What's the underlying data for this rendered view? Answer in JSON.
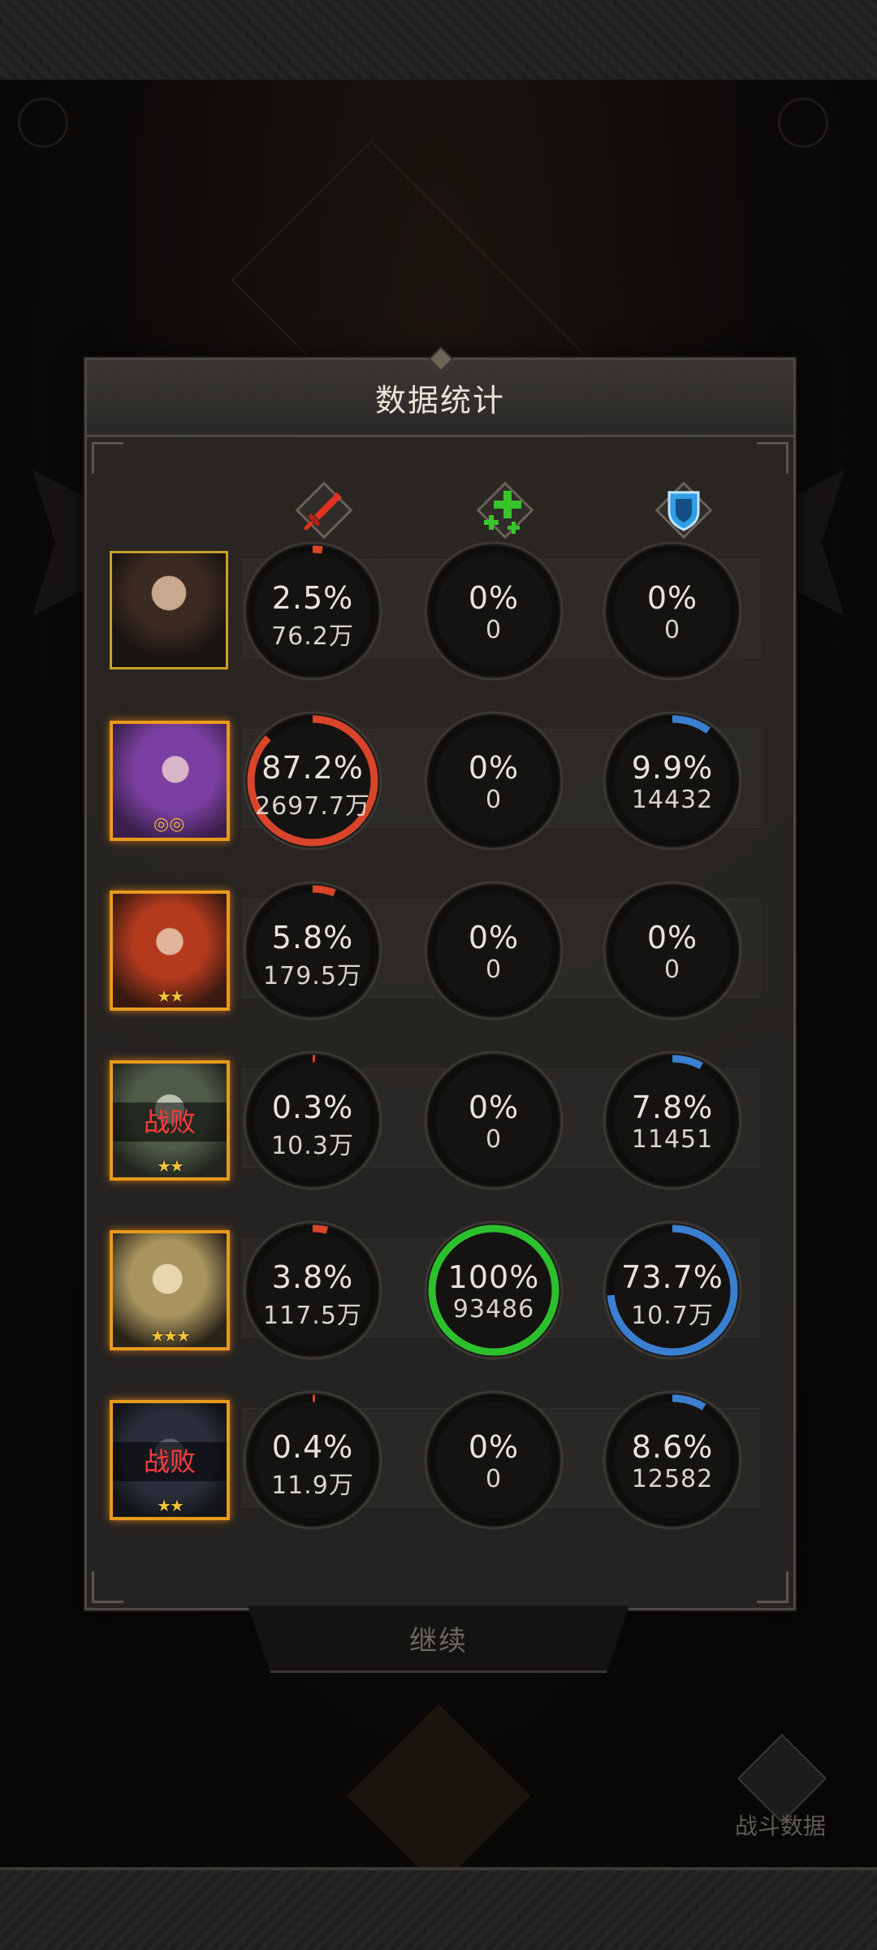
{
  "panel": {
    "title": "数据统计"
  },
  "columns": [
    {
      "name": "damage",
      "icon": "sword-icon",
      "color": "#e0331f"
    },
    {
      "name": "heal",
      "icon": "heal-cross-icon",
      "color": "#39c42a"
    },
    {
      "name": "defense",
      "icon": "shield-icon",
      "color": "#2f9fe6"
    }
  ],
  "colors": {
    "damage_ring": "#d9452a",
    "heal_ring": "#2cc12c",
    "defense_ring": "#3b7fd0",
    "defeated_text": "#ff3b3b"
  },
  "heroes": [
    {
      "defeated": false,
      "defeat_label": "",
      "stars": "",
      "damage": {
        "pct": "2.5%",
        "amount": "76.2万",
        "fill": 0.025
      },
      "heal": {
        "pct": "0%",
        "amount": "0",
        "fill": 0
      },
      "defense": {
        "pct": "0%",
        "amount": "0",
        "fill": 0
      }
    },
    {
      "defeated": false,
      "defeat_label": "",
      "stars": "",
      "damage": {
        "pct": "87.2%",
        "amount": "2697.7万",
        "fill": 0.872
      },
      "heal": {
        "pct": "0%",
        "amount": "0",
        "fill": 0
      },
      "defense": {
        "pct": "9.9%",
        "amount": "14432",
        "fill": 0.099
      }
    },
    {
      "defeated": false,
      "defeat_label": "",
      "stars": "★★",
      "damage": {
        "pct": "5.8%",
        "amount": "179.5万",
        "fill": 0.058
      },
      "heal": {
        "pct": "0%",
        "amount": "0",
        "fill": 0
      },
      "defense": {
        "pct": "0%",
        "amount": "0",
        "fill": 0
      }
    },
    {
      "defeated": true,
      "defeat_label": "战败",
      "stars": "★★",
      "damage": {
        "pct": "0.3%",
        "amount": "10.3万",
        "fill": 0.003
      },
      "heal": {
        "pct": "0%",
        "amount": "0",
        "fill": 0
      },
      "defense": {
        "pct": "7.8%",
        "amount": "11451",
        "fill": 0.078
      }
    },
    {
      "defeated": false,
      "defeat_label": "",
      "stars": "★★★",
      "damage": {
        "pct": "3.8%",
        "amount": "117.5万",
        "fill": 0.038
      },
      "heal": {
        "pct": "100%",
        "amount": "93486",
        "fill": 1.0
      },
      "defense": {
        "pct": "73.7%",
        "amount": "10.7万",
        "fill": 0.737
      }
    },
    {
      "defeated": true,
      "defeat_label": "战败",
      "stars": "★★",
      "damage": {
        "pct": "0.4%",
        "amount": "11.9万",
        "fill": 0.004
      },
      "heal": {
        "pct": "0%",
        "amount": "0",
        "fill": 0
      },
      "defense": {
        "pct": "8.6%",
        "amount": "12582",
        "fill": 0.086
      }
    }
  ],
  "continue_label": "继续",
  "battle_data_label": "战斗数据"
}
